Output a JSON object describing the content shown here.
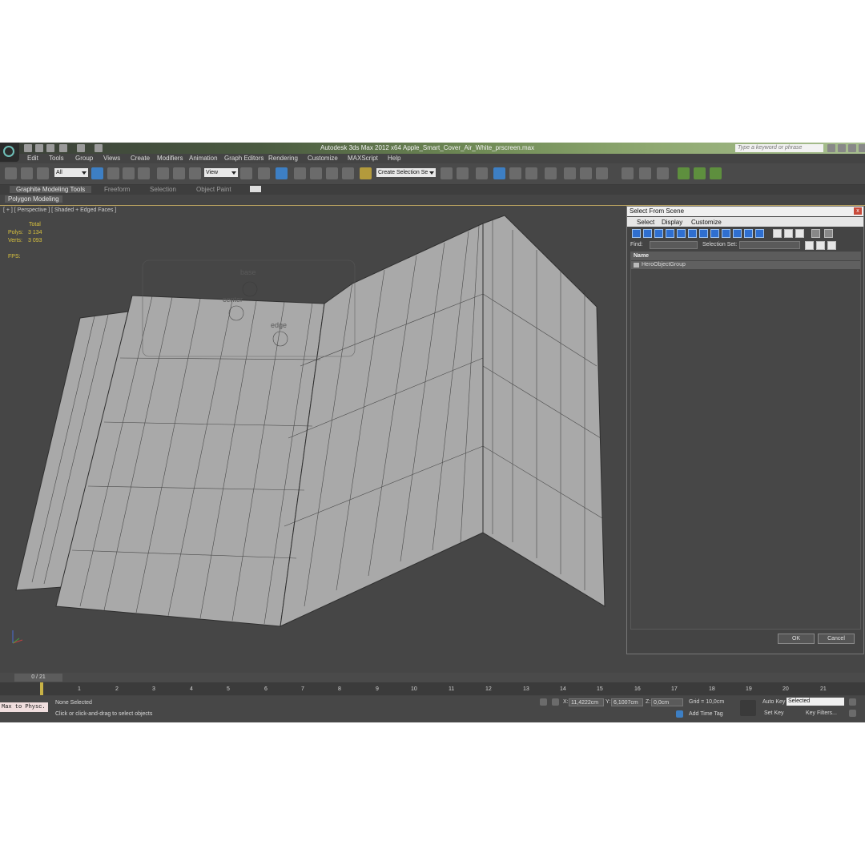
{
  "window": {
    "title": "Autodesk 3ds Max  2012 x64",
    "file": "Apple_Smart_Cover_Air_White_prscreen.max",
    "search_placeholder": "Type a keyword or phrase"
  },
  "menu": [
    "Edit",
    "Tools",
    "Group",
    "Views",
    "Create",
    "Modifiers",
    "Animation",
    "Graph Editors",
    "Rendering",
    "Customize",
    "MAXScript",
    "Help"
  ],
  "toolbar": {
    "selection_filter": "All",
    "ref_coord": "View",
    "named_selection": "Create Selection Se"
  },
  "ribbon": {
    "tabs": [
      "Graphite Modeling Tools",
      "Freeform",
      "Selection",
      "Object Paint"
    ],
    "sub_tab": "Polygon Modeling"
  },
  "viewport": {
    "label": "[ + ] [ Perspective ] [ Shaded + Edged Faces ]",
    "stats": {
      "total_label": "Total",
      "polys_label": "Polys:",
      "polys_value": "3 134",
      "verts_label": "Verts:",
      "verts_value": "3 093",
      "fps_label": "FPS:"
    },
    "helpers": [
      "base",
      "center",
      "edge"
    ]
  },
  "select_dialog": {
    "title": "Select From Scene",
    "close": "x",
    "menu": [
      "Select",
      "Display",
      "Customize"
    ],
    "find_label": "Find:",
    "selection_set_label": "Selection Set:",
    "column_name": "Name",
    "items": [
      "HeroObjectGroup"
    ],
    "ok": "OK",
    "cancel": "Cancel"
  },
  "timeline": {
    "slider": "0 / 21",
    "ticks": [
      "1",
      "2",
      "3",
      "4",
      "5",
      "6",
      "7",
      "8",
      "9",
      "10",
      "11",
      "12",
      "13",
      "14",
      "15",
      "16",
      "17",
      "18",
      "19",
      "20",
      "21"
    ]
  },
  "status": {
    "maxscript": "Max to Physc.",
    "selection": "None Selected",
    "prompt": "Click or click-and-drag to select objects",
    "x_label": "X:",
    "x_value": "11,4222cm",
    "y_label": "Y:",
    "y_value": "6,1007cm",
    "z_label": "Z:",
    "z_value": "0,0cm",
    "grid": "Grid = 10,0cm",
    "add_time_tag": "Add Time Tag",
    "auto_key": "Auto Key",
    "auto_key_mode": "Selected",
    "set_key": "Set Key",
    "key_filters": "Key Filters..."
  },
  "colors": {
    "viewport_bg": "#464646",
    "stats_text": "#d9c23e",
    "wire": "#2f2f2f",
    "mesh_fill": "#a9a9a9",
    "active_border": "#b8a160"
  }
}
